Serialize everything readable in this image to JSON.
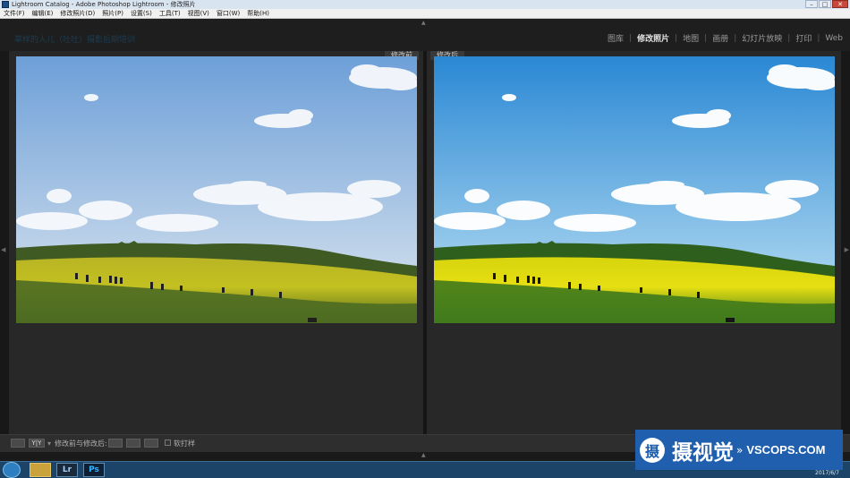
{
  "window": {
    "title": "Lightroom Catalog - Adobe Photoshop Lightroom - 修改照片",
    "minimize": "–",
    "maximize": "□",
    "close": "✕"
  },
  "menu": [
    "文件(F)",
    "编辑(E)",
    "修改照片(D)",
    "照片(P)",
    "设置(S)",
    "工具(T)",
    "视图(V)",
    "窗口(W)",
    "帮助(H)"
  ],
  "identity_plate": "草样的人儿（吐吐）摄影后期培训",
  "modules": [
    {
      "label": "图库",
      "active": false
    },
    {
      "label": "修改照片",
      "active": true
    },
    {
      "label": "地图",
      "active": false
    },
    {
      "label": "画册",
      "active": false
    },
    {
      "label": "幻灯片放映",
      "active": false
    },
    {
      "label": "打印",
      "active": false
    },
    {
      "label": "Web",
      "active": false
    }
  ],
  "view": {
    "before_label": "修改前",
    "after_label": "修改后"
  },
  "toolbar": {
    "view_mode_label": "Y|Y",
    "swap_label": "修改前与修改后:",
    "softproof_label": "软打样"
  },
  "watermark": {
    "logo_char": "摄",
    "name": "摄视觉",
    "chevrons": "»",
    "site": "VSCOPS.COM"
  },
  "taskbar": {
    "lr_label": "Lr",
    "ps_label": "Ps",
    "clock": "2017/6/7"
  },
  "colors": {
    "before_sky_top": "#6d9fd8",
    "before_sky_bottom": "#dce6ef",
    "after_sky_top": "#2a88d4",
    "after_sky_bottom": "#bfe2f4",
    "after_field": "#e6df12",
    "before_field": "#c3c021",
    "accent_watermark": "#1f5fae"
  }
}
